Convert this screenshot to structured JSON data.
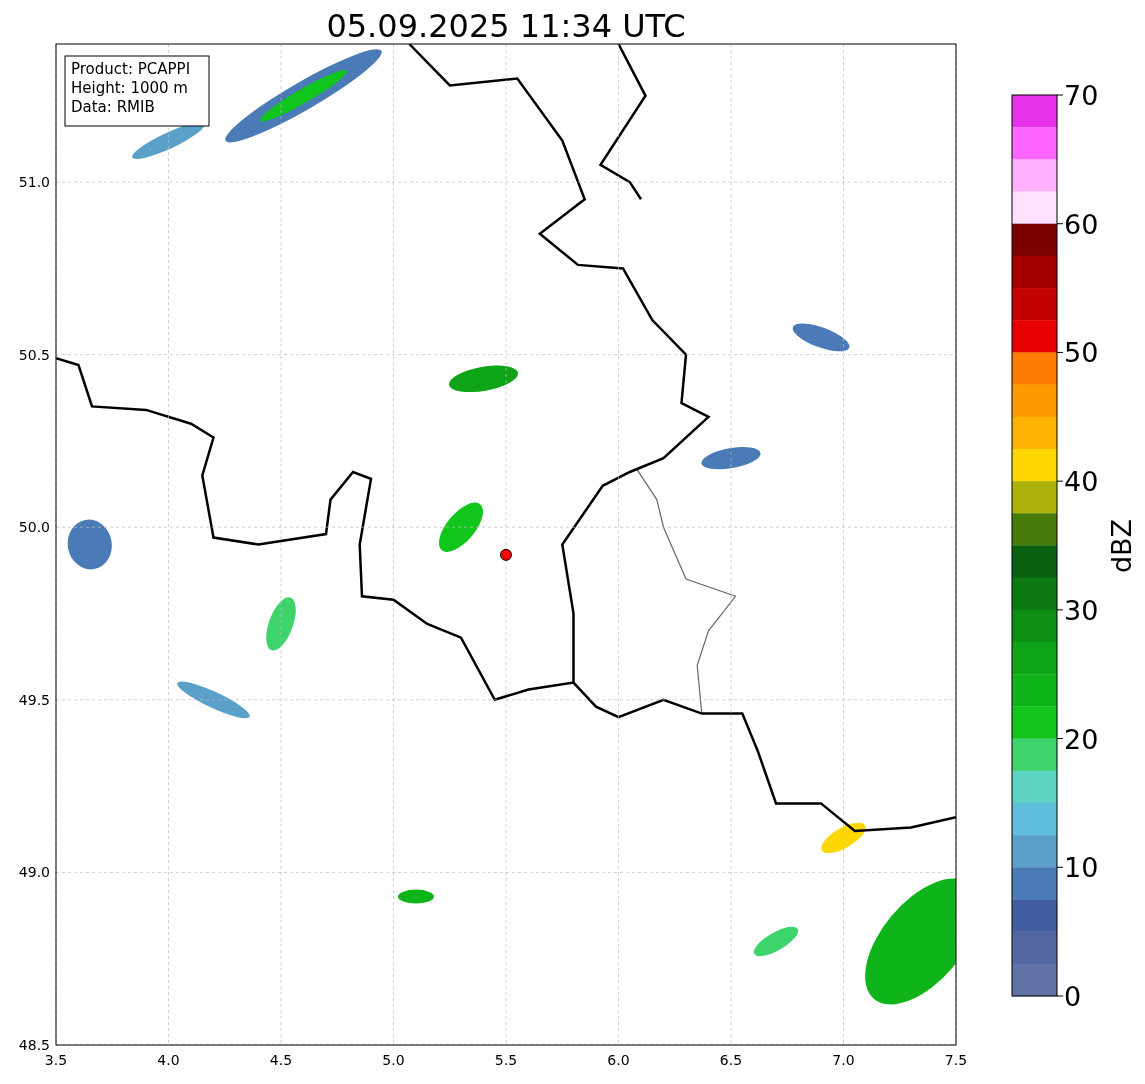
{
  "chart": {
    "chart_data": {
      "type": "scatter",
      "title": "05.09.2025 11:34 UTC",
      "xlim": [
        3.5,
        7.5
      ],
      "ylim": [
        48.5,
        51.4
      ],
      "xticks": [
        {
          "value": 3.5,
          "label": "3.5"
        },
        {
          "value": 4,
          "label": "4.0"
        },
        {
          "value": 4.5,
          "label": "4.5"
        },
        {
          "value": 5,
          "label": "5.0"
        },
        {
          "value": 5.5,
          "label": "5.5"
        },
        {
          "value": 6,
          "label": "6.0"
        },
        {
          "value": 6.5,
          "label": "6.5"
        },
        {
          "value": 7,
          "label": "7.0"
        },
        {
          "value": 7.5,
          "label": "7.5"
        }
      ],
      "yticks": [
        {
          "value": 48.5,
          "label": "48.5"
        },
        {
          "value": 49,
          "label": "49.0"
        },
        {
          "value": 49.5,
          "label": "49.5"
        },
        {
          "value": 50,
          "label": "50.0"
        },
        {
          "value": 50.5,
          "label": "50.5"
        },
        {
          "value": 51,
          "label": "51.0"
        }
      ],
      "grid": true,
      "x": [
        5.5
      ],
      "series": [
        {
          "color": "#ff0000",
          "values": [
            49.92
          ]
        }
      ]
    }
  },
  "info_box": [
    "Product: PCAPPI",
    "Height: 1000 m",
    "Data: RMIB"
  ],
  "colorbar": {
    "label": "dBZ",
    "ticks": [
      "70",
      "60",
      "50",
      "40",
      "30",
      "20",
      "10",
      "0"
    ],
    "bins": [
      {
        "color": "#e832ea"
      },
      {
        "color": "#ff66ff"
      },
      {
        "color": "#ffb0ff"
      },
      {
        "color": "#ffe0ff"
      },
      {
        "color": "#7d0000"
      },
      {
        "color": "#a50000"
      },
      {
        "color": "#c40000"
      },
      {
        "color": "#e60000"
      },
      {
        "color": "#ff7c00"
      },
      {
        "color": "#ff9a00"
      },
      {
        "color": "#ffb300"
      },
      {
        "color": "#ffd700"
      },
      {
        "color": "#adb30a"
      },
      {
        "color": "#487c0a"
      },
      {
        "color": "#0a5f10"
      },
      {
        "color": "#0b7812"
      },
      {
        "color": "#0e8f14"
      },
      {
        "color": "#0fa317"
      },
      {
        "color": "#0fb31a"
      },
      {
        "color": "#10c51c"
      },
      {
        "color": "#3dd46c"
      },
      {
        "color": "#5dd3c0"
      },
      {
        "color": "#62bfdc"
      },
      {
        "color": "#5aa0c8"
      },
      {
        "color": "#4a7bb7"
      },
      {
        "color": "#435ea0"
      },
      {
        "color": "#5267a0"
      },
      {
        "color": "#6372a4"
      }
    ]
  }
}
